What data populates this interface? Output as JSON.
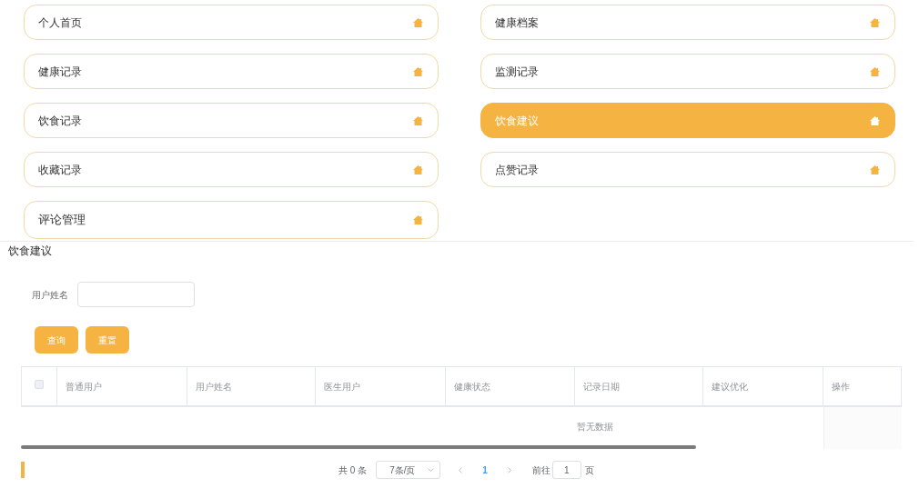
{
  "menu": {
    "columns": [
      [
        {
          "label": "个人首页",
          "selected": false,
          "kind": "normal"
        },
        {
          "label": "健康记录",
          "selected": false,
          "kind": "normal"
        },
        {
          "label": "饮食记录",
          "selected": false,
          "kind": "normal"
        },
        {
          "label": "收藏记录",
          "selected": false,
          "kind": "normal"
        },
        {
          "label": "评论管理",
          "selected": false,
          "kind": "large"
        }
      ],
      [
        {
          "label": "健康档案",
          "selected": false,
          "kind": "normal"
        },
        {
          "label": "监测记录",
          "selected": false,
          "kind": "normal"
        },
        {
          "label": "饮食建议",
          "selected": true,
          "kind": "normal"
        },
        {
          "label": "点赞记录",
          "selected": false,
          "kind": "normal"
        }
      ]
    ]
  },
  "page_title": "饮食建议",
  "search": {
    "label": "用户姓名"
  },
  "buttons": [
    "查询",
    "重置"
  ],
  "table": {
    "select_all": {
      "checked": false
    },
    "columns": [
      "普通用户",
      "用户姓名",
      "医生用户",
      "健康状态",
      "记录日期",
      "建议优化",
      "操作"
    ],
    "empty_text": "暂无数据"
  },
  "pagination": {
    "total": "共 0 条",
    "page_size": "7条/页",
    "pages": [
      {
        "label": "1",
        "selected": true
      }
    ],
    "goto_label": "前往",
    "goto_value": "1",
    "goto_suffix": "页"
  }
}
